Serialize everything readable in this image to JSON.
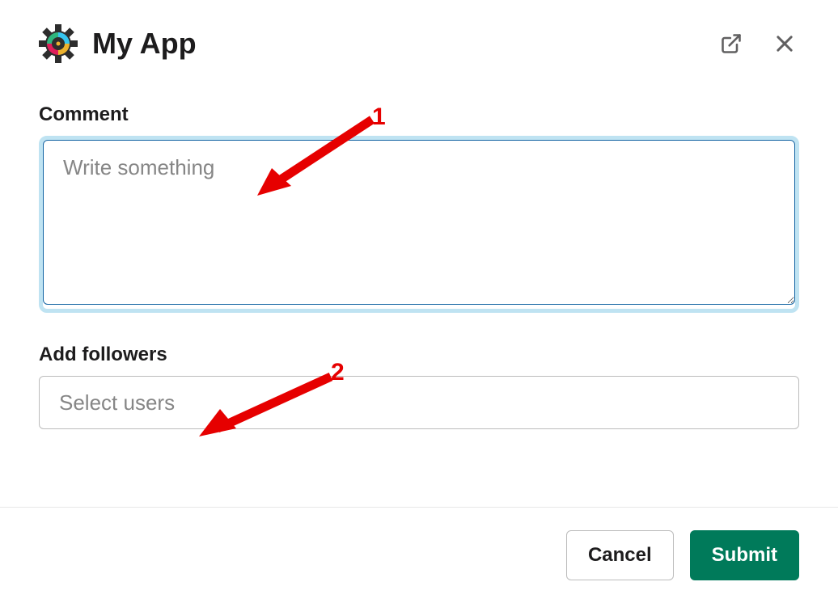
{
  "header": {
    "app_title": "My App"
  },
  "comment": {
    "label": "Comment",
    "placeholder": "Write something",
    "value": ""
  },
  "followers": {
    "label": "Add followers",
    "placeholder": "Select users",
    "value": ""
  },
  "footer": {
    "cancel_label": "Cancel",
    "submit_label": "Submit"
  },
  "annotations": {
    "one": "1",
    "two": "2"
  }
}
